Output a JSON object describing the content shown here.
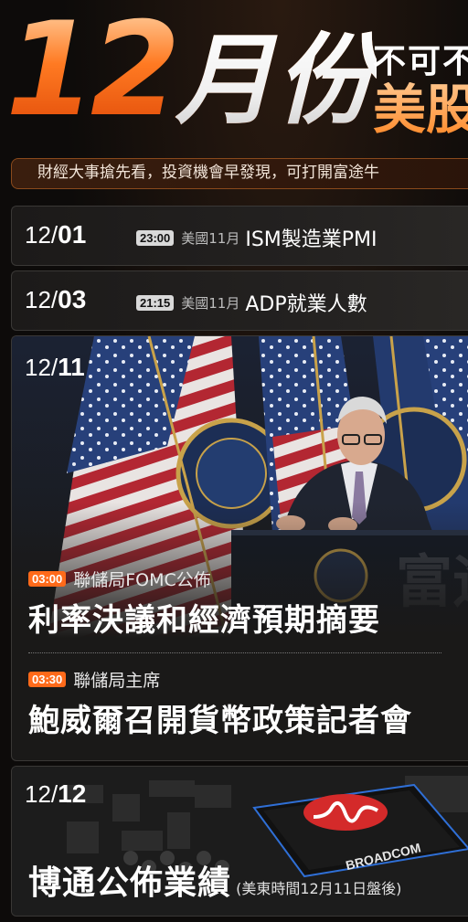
{
  "header": {
    "month_number": "12",
    "month_word": "月份",
    "side_line1": "不可不",
    "side_line2": "美股",
    "subtitle": "財經大事搶先看，投資機會早發現，可打開富途牛"
  },
  "events": [
    {
      "date_day": "12/",
      "date_num": "01",
      "time": "23:00",
      "meta": "美國11月",
      "title": "ISM製造業PMI"
    },
    {
      "date_day": "12/",
      "date_num": "03",
      "time": "21:15",
      "meta": "美國11月",
      "title": "ADP就業人數"
    }
  ],
  "fomc": {
    "date_day": "12/",
    "date_num": "11",
    "item1_time": "03:00",
    "item1_label": "聯儲局FOMC公佈",
    "item1_title": "利率決議和經濟預期摘要",
    "item2_time": "03:30",
    "item2_label": "聯儲局主席",
    "item2_title": "鮑威爾召開貨幣政策記者會",
    "watermark": "富途"
  },
  "broadcom": {
    "date_day": "12/",
    "date_num": "12",
    "title": "博通公佈業績",
    "note": "(美東時間12月11日盤後)",
    "chip_brand": "BROADCOM"
  },
  "colors": {
    "accent": "#ff6a1a",
    "card_bg": "#1f1d1c",
    "pill_grey": "#d9d9d9"
  }
}
